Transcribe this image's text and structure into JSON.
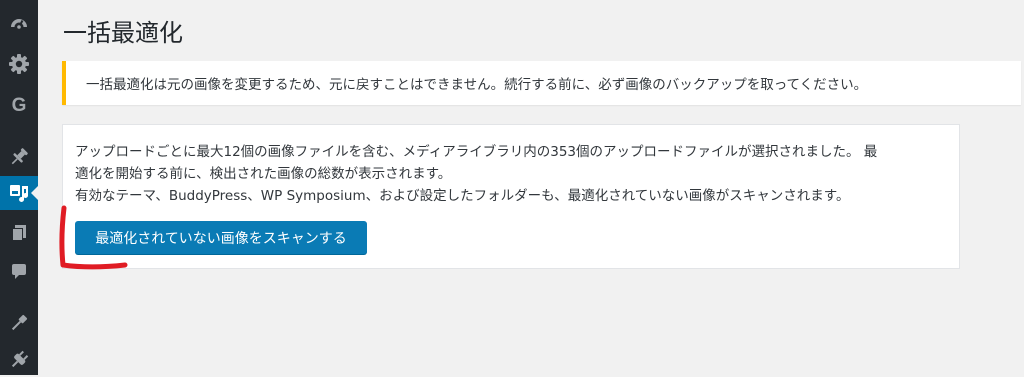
{
  "sidebar": {
    "items": [
      {
        "icon": "dashboard-icon",
        "active": false
      },
      {
        "icon": "gear-icon",
        "active": false
      },
      {
        "icon": "g-icon",
        "label": "G",
        "active": false
      },
      {
        "icon": "pin-icon",
        "active": false
      },
      {
        "icon": "media-icon",
        "active": true
      },
      {
        "icon": "pages-icon",
        "active": false
      },
      {
        "icon": "comment-icon",
        "active": false
      },
      {
        "icon": "appearance-icon",
        "active": false
      },
      {
        "icon": "plugins-icon",
        "active": false
      }
    ]
  },
  "page": {
    "title": "一括最適化"
  },
  "notice": {
    "text": "一括最適化は元の画像を変更するため、元に戻すことはできません。続行する前に、必ず画像のバックアップを取ってください。",
    "accent_color": "#ffb900"
  },
  "card": {
    "line1": "アップロードごとに最大12個の画像ファイルを含む、メディアライブラリ内の353個のアップロードファイルが選択されました。 最",
    "line2": "適化を開始する前に、検出された画像の総数が表示されます。",
    "line3": "有効なテーマ、BuddyPress、WP Symposium、および設定したフォルダーも、最適化されていない画像がスキャンされます。",
    "scan_button_label": "最適化されていない画像をスキャンする"
  },
  "colors": {
    "sidebar_bg": "#23282d",
    "active_menu": "#0073aa",
    "button": "#0a7bb5",
    "annotation_mark": "#e01c24"
  }
}
